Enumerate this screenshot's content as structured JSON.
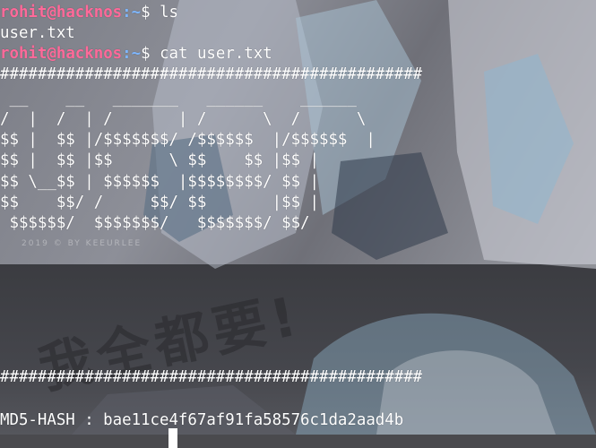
{
  "terminal": {
    "prompt_user": "rohit",
    "prompt_host": "hacknos",
    "prompt_path": ":~",
    "prompt_symbol": "$",
    "cmd1": "ls",
    "ls_output": "user.txt",
    "cmd2": "cat user.txt",
    "hash_border": "#############################################",
    "art": [
      " __    __   _______   ______    ______",
      "/  |  /  | /       | /      \\  /      \\",
      "$$ |  $$ |/$$$$$$$/ /$$$$$$  |/$$$$$$  |",
      "$$ |  $$ |$$      \\ $$    $$ |$$ |",
      "$$ \\__$$ | $$$$$$  |$$$$$$$$/ $$ |",
      "$$    $$/ /     $$/ $$       |$$ |",
      " $$$$$$/  $$$$$$$/   $$$$$$$/ $$/"
    ],
    "md5_line": "MD5-HASH : bae11ce4f67af91fa58576c1da2aad4b"
  },
  "wallpaper": {
    "copyright": "2019 © BY KEEURLEE",
    "stamp_text": "我全都要!"
  }
}
